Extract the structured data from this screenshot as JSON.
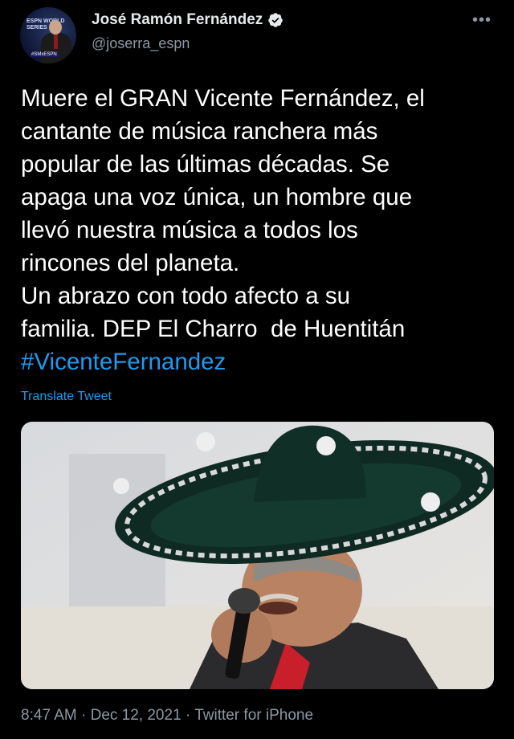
{
  "author": {
    "display_name": "José Ramón Fernández",
    "handle": "@joserra_espn",
    "avatar_text_top": "ESPN WORLD SERIES",
    "avatar_badge": "#SMxESPN"
  },
  "tweet": {
    "text": "Muere el GRAN Vicente Fernández, el\ncantante de música ranchera más\npopular de las últimas décadas. Se\napaga una voz única, un hombre que\nllevó nuestra música a todos los\nrincones del planeta.\nUn abrazo con todo afecto a su\nfamilia. DEP El Charro  de Huentitán",
    "hashtag": "#VicenteFernandez",
    "translate_label": "Translate Tweet"
  },
  "meta": {
    "time": "8:47 AM",
    "date": "Dec 12, 2021",
    "source": "Twitter for iPhone",
    "separator": "·"
  },
  "icons": [
    "verified-badge-icon",
    "more-options-icon"
  ],
  "colors": {
    "link": "#1d9bf0",
    "secondary": "#8b98a5",
    "background": "#000000"
  }
}
